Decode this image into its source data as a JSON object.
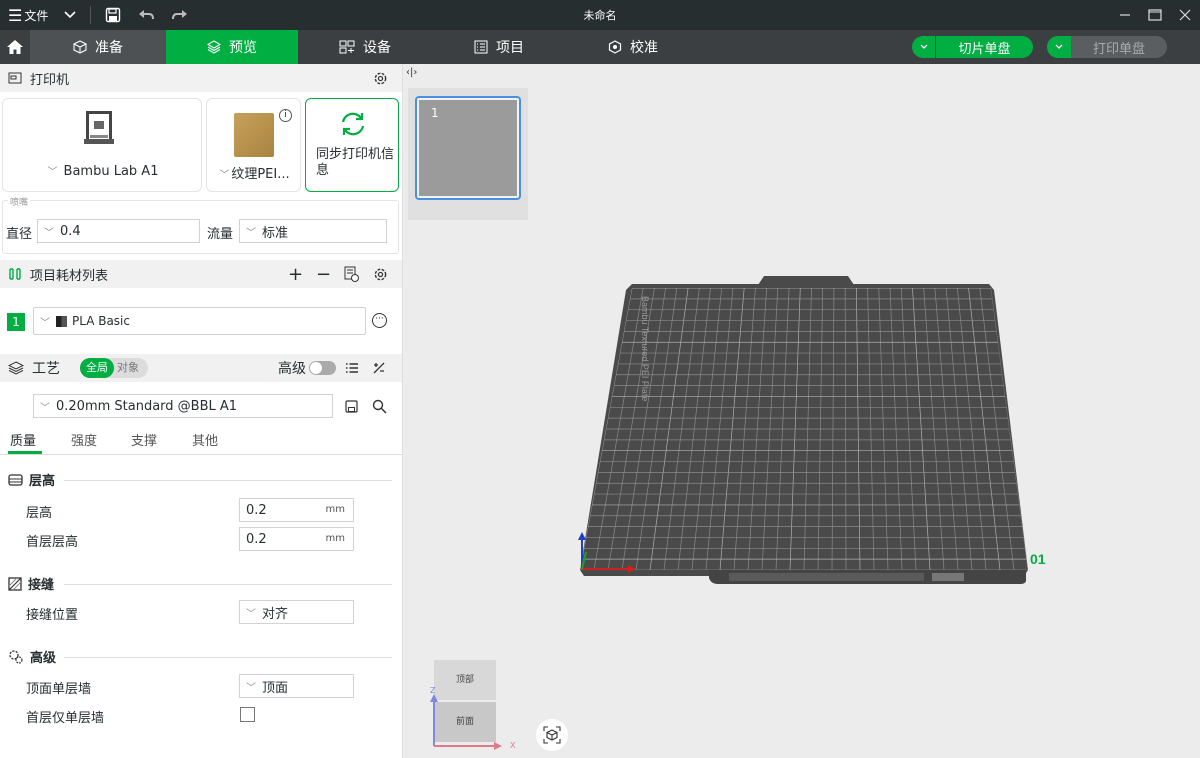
{
  "titlebar": {
    "menu_label": "文件",
    "title": "未命名"
  },
  "tabs": {
    "prepare": "准备",
    "preview": "预览",
    "device": "设备",
    "project": "项目",
    "calibration": "校准"
  },
  "actions": {
    "slice_plate": "切片单盘",
    "print_plate": "打印单盘"
  },
  "printer": {
    "section_title": "打印机",
    "model": "Bambu Lab A1",
    "plate": "纹理PEI...",
    "sync_label": "同步打印机信息",
    "nozzle_group": "喷嘴",
    "diameter_label": "直径",
    "diameter_value": "0.4",
    "flow_label": "流量",
    "flow_value": "标准"
  },
  "filament": {
    "section_title": "项目耗材列表",
    "slot_index": "1",
    "name": "PLA Basic"
  },
  "process": {
    "section_title": "工艺",
    "toggle_global": "全局",
    "toggle_object": "对象",
    "advanced_label": "高级",
    "preset": "0.20mm Standard @BBL A1",
    "subtabs": [
      "质量",
      "强度",
      "支撑",
      "其他"
    ],
    "groups": {
      "layer_height": {
        "title": "层高",
        "layer_height_label": "层高",
        "layer_height_value": "0.2",
        "first_layer_label": "首层层高",
        "first_layer_value": "0.2",
        "unit": "mm"
      },
      "seam": {
        "title": "接缝",
        "position_label": "接缝位置",
        "position_value": "对齐"
      },
      "advanced": {
        "title": "高级",
        "top_single_wall_label": "顶面单层墙",
        "top_single_wall_value": "顶面",
        "first_layer_single_wall_label": "首层仅单层墙",
        "first_layer_single_wall_checked": false
      }
    }
  },
  "viewport": {
    "plate_thumb_index": "1",
    "plate_number": "01",
    "plate_text": "Bambu Textured PEI Plate",
    "cube_top": "顶部",
    "cube_front": "前面",
    "axis_x": "X",
    "axis_z": "Z"
  },
  "colors": {
    "accent": "#00ae42",
    "titlebar_bg": "#262e30",
    "tabbar_bg": "#3c3f41",
    "plate": "#4a4a4a"
  }
}
